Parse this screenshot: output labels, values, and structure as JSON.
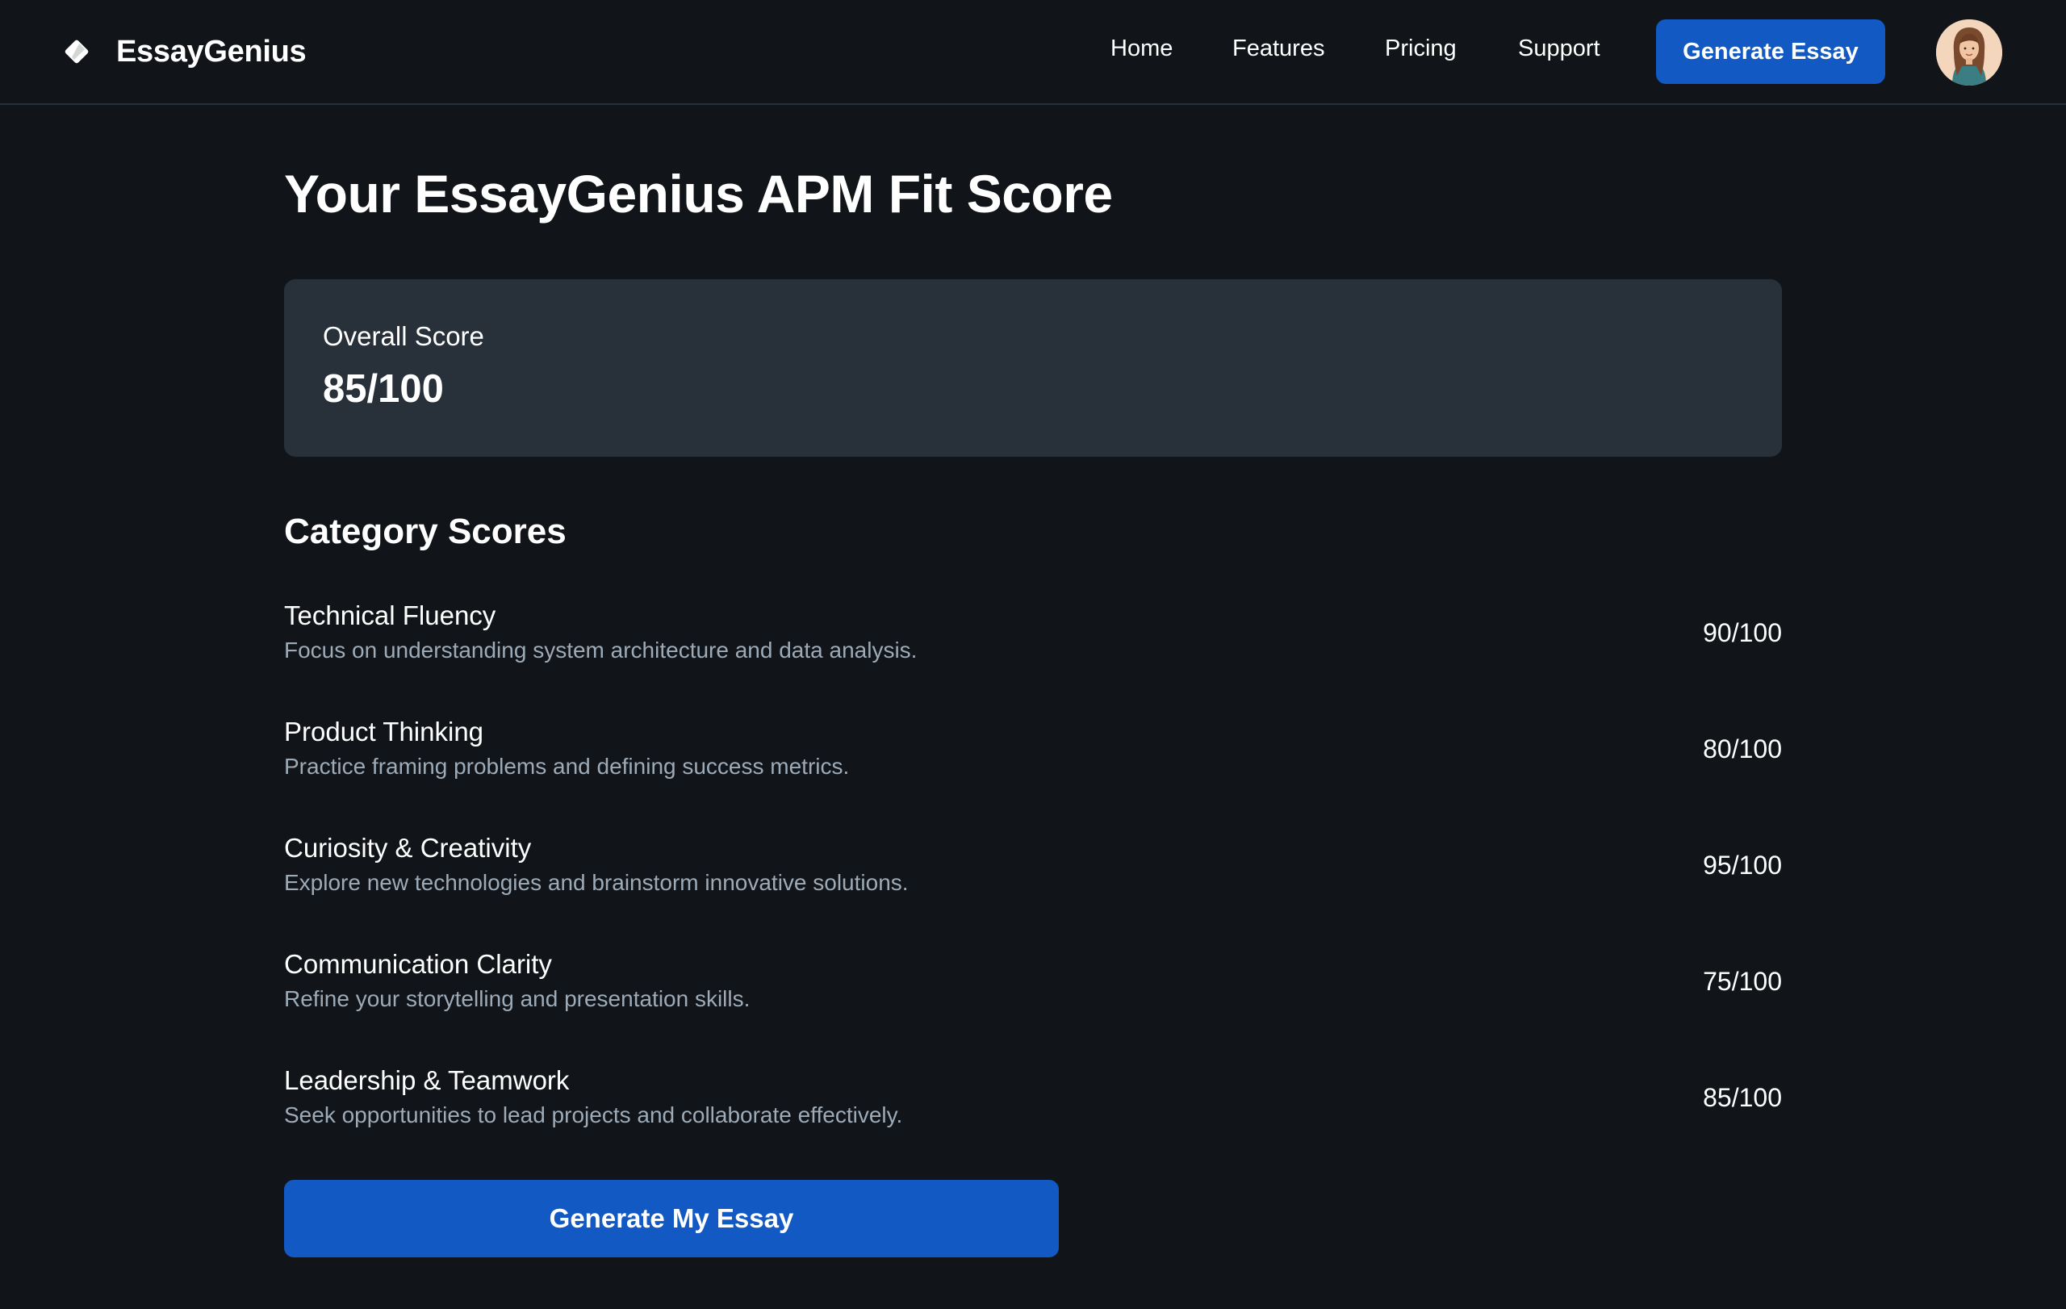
{
  "header": {
    "brand_name": "EssayGenius",
    "brand_icon": "diamond-logo-icon",
    "nav": [
      {
        "label": "Home"
      },
      {
        "label": "Features"
      },
      {
        "label": "Pricing"
      },
      {
        "label": "Support"
      }
    ],
    "cta_label": "Generate Essay",
    "avatar_icon": "user-avatar"
  },
  "main": {
    "title": "Your EssayGenius APM Fit Score",
    "overall": {
      "label": "Overall Score",
      "value": "85/100"
    },
    "categories_title": "Category Scores",
    "categories": [
      {
        "name": "Technical Fluency",
        "description": "Focus on understanding system architecture and data analysis.",
        "score": "90/100"
      },
      {
        "name": "Product Thinking",
        "description": "Practice framing problems and defining success metrics.",
        "score": "80/100"
      },
      {
        "name": "Curiosity & Creativity",
        "description": "Explore new technologies and brainstorm innovative solutions.",
        "score": "95/100"
      },
      {
        "name": "Communication Clarity",
        "description": "Refine your storytelling and presentation skills.",
        "score": "75/100"
      },
      {
        "name": "Leadership & Teamwork",
        "description": "Seek opportunities to lead projects and collaborate effectively.",
        "score": "85/100"
      }
    ],
    "cta_label": "Generate My Essay"
  },
  "colors": {
    "background": "#111418",
    "card": "#283039",
    "accent": "#1259c3",
    "muted_text": "#9dabb8",
    "divider": "#283039"
  }
}
